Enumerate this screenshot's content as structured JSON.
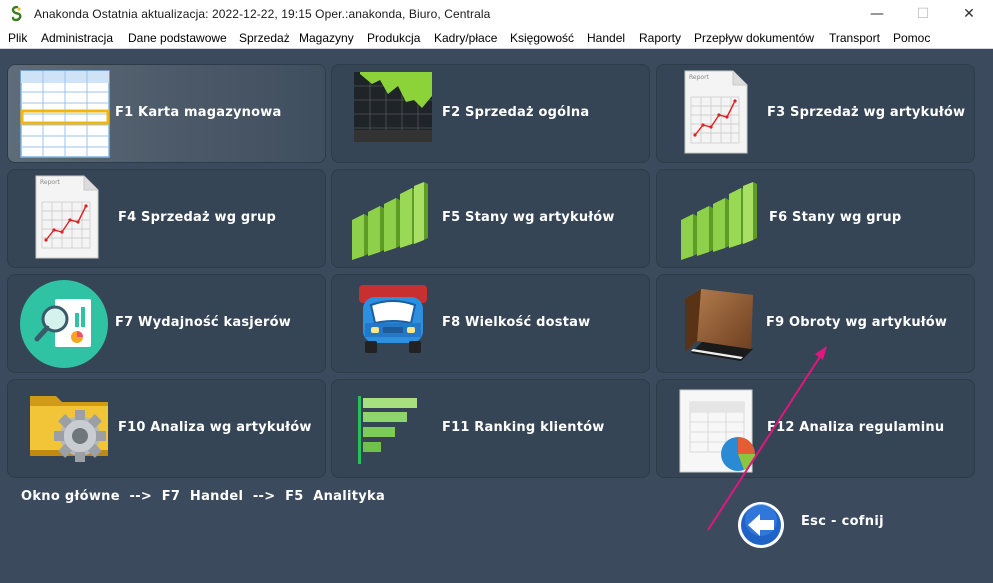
{
  "window": {
    "title": "Anakonda Ostatnia aktualizacja: 2022-12-22, 19:15 Oper.:anakonda, Biuro, Centrala",
    "minimize": "—",
    "maximize": "☐",
    "close": "✕"
  },
  "menu": [
    "Plik",
    "Administracja",
    "Dane podstawowe",
    "Sprzedaż",
    "Magazyny",
    "Produkcja",
    "Kadry/płace",
    "Księgowość",
    "Handel",
    "Raporty",
    "Przepływ dokumentów",
    "Transport",
    "Pomoc"
  ],
  "tiles": [
    {
      "label": "F1  Karta magazynowa",
      "icon": "spreadsheet-icon"
    },
    {
      "label": "F2  Sprzedaż ogólna",
      "icon": "area-chart-icon"
    },
    {
      "label": "F3  Sprzedaż wg artykułów",
      "icon": "report-icon"
    },
    {
      "label": "F4  Sprzedaż wg grup",
      "icon": "report-icon"
    },
    {
      "label": "F5  Stany wg artykułów",
      "icon": "green-bars-icon"
    },
    {
      "label": "F6  Stany wg grup",
      "icon": "green-bars-icon"
    },
    {
      "label": "F7  Wydajność kasjerów",
      "icon": "analytics-magnifier-icon"
    },
    {
      "label": "F8  Wielkość dostaw",
      "icon": "truck-icon"
    },
    {
      "label": "F9  Obroty wg artykułów",
      "icon": "book-icon"
    },
    {
      "label": "F10  Analiza wg artykułów",
      "icon": "folder-gear-icon"
    },
    {
      "label": "F11  Ranking klientów",
      "icon": "bar-ranking-icon"
    },
    {
      "label": "F12  Analiza regulaminu",
      "icon": "sheet-pie-icon"
    }
  ],
  "breadcrumb": "Okno główne  -->  F7  Handel  -->  F5  Analityka",
  "back": {
    "label": "Esc - cofnij",
    "icon": "back-arrow-icon"
  },
  "colors": {
    "background": "#3b4b5d",
    "tile": "#354555",
    "tile_active": "#5f6c79",
    "annotation_arrow": "#e0177d"
  }
}
